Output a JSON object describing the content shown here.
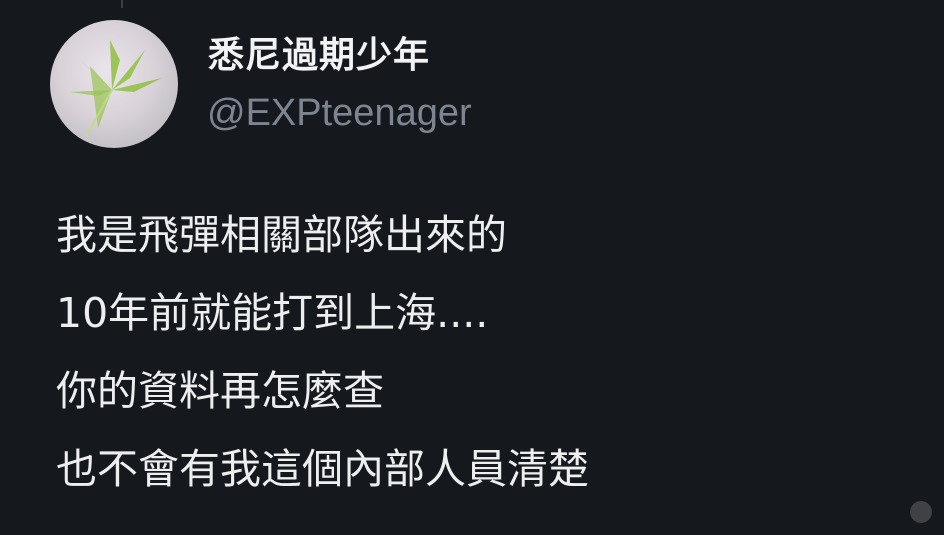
{
  "tweet": {
    "display_name": "悉尼過期少年",
    "handle": "@EXPteenager",
    "lines": [
      "我是飛彈相關部隊出來的",
      "10年前就能打到上海....",
      "你的資料再怎麼查",
      "也不會有我這個內部人員清楚"
    ]
  },
  "colors": {
    "background": "#15181d",
    "text": "#eceef0",
    "handle": "#7c8590"
  },
  "icons": {
    "avatar": "cannabis-leaf-avatar"
  }
}
